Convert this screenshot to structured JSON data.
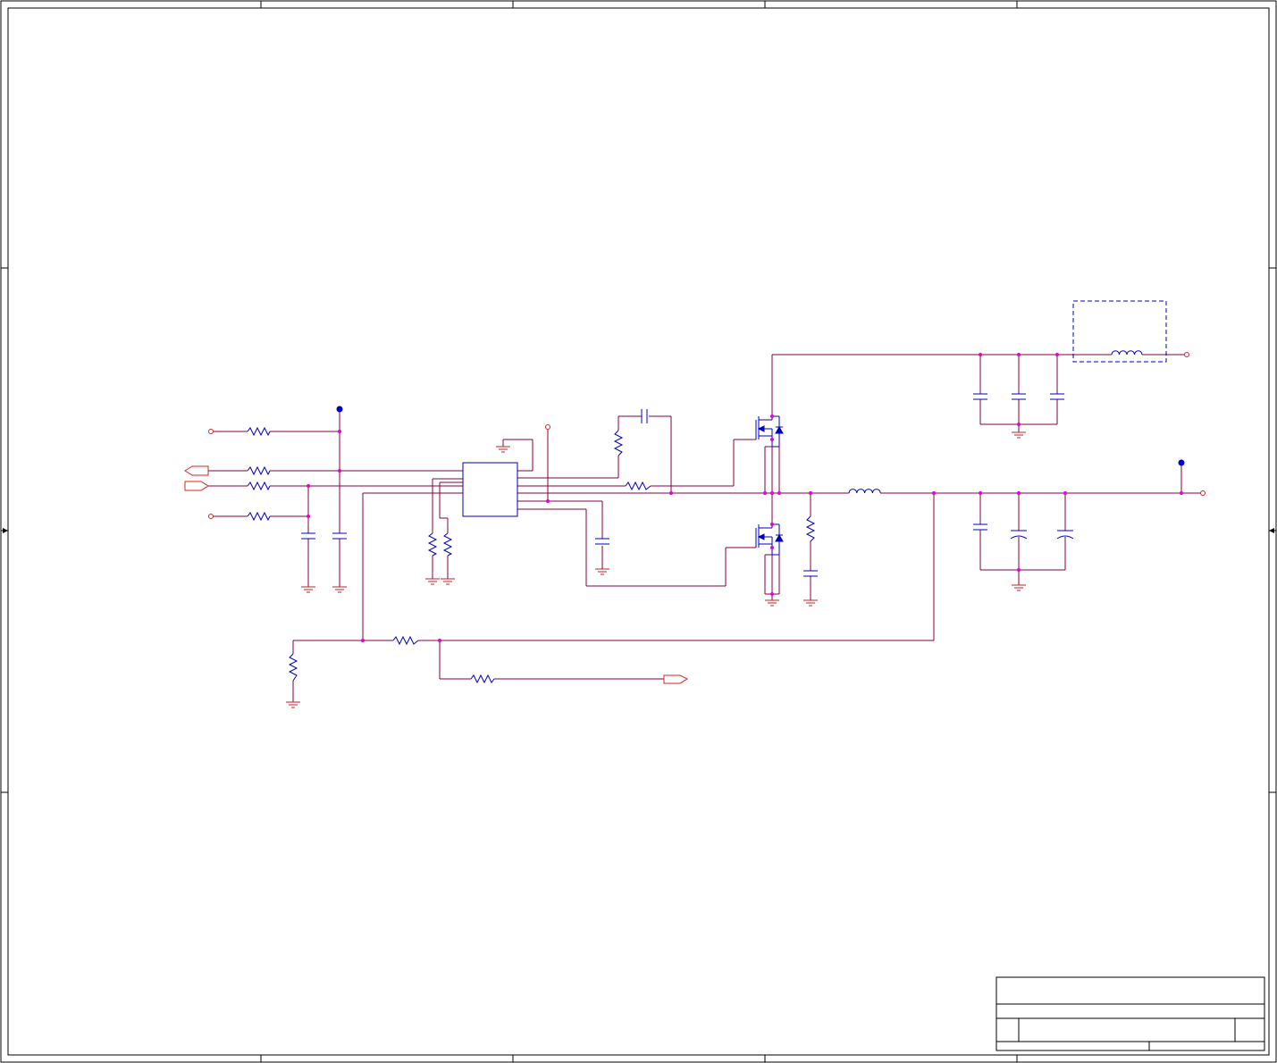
{
  "sheet": {
    "frame_color": "#000000",
    "wire_color": "#800040",
    "part_color": "#0000c0",
    "port_color": "#e02020",
    "junction_color": "#e000e0",
    "power_dot_color": "#0000d0",
    "background": "#ffffff",
    "border_arrow_icon": "triangle-arrow"
  },
  "title_block": {
    "title": "",
    "document_number": "",
    "size": "",
    "revision": "",
    "date": "",
    "sheet_of": ""
  }
}
